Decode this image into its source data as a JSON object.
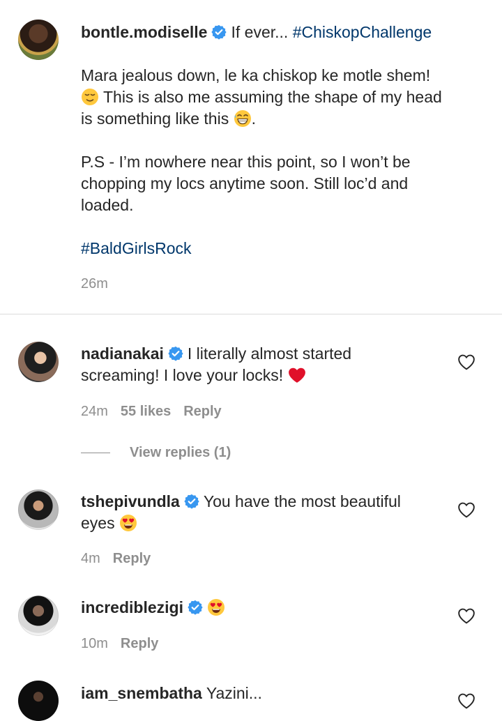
{
  "caption": {
    "username": "bontle.modiselle",
    "first_text": "If ever... ",
    "first_hashtag": "#ChiskopChallenge",
    "p1_a": "Mara jealous down, le ka chiskop ke motle shem!",
    "p1_b": "This is also me assuming the shape of my head",
    "p1_c": "is something like this",
    "p1_c_end": ".",
    "p2_a": "P.S - I’m nowhere near this point, so I won’t be",
    "p2_b": "chopping my locs anytime soon. Still loc’d and",
    "p2_c": "loaded.",
    "hashtag": "#BaldGirlsRock",
    "time": "26m"
  },
  "comments": [
    {
      "username": "nadianakai",
      "text_a": "I literally almost started",
      "text_b": "screaming! I love your locks!",
      "time": "24m",
      "likes": "55 likes",
      "reply": "Reply",
      "view_replies": "View replies (1)"
    },
    {
      "username": "tshepivundla",
      "text_a": "You have the most beautiful",
      "text_b": "eyes",
      "time": "4m",
      "reply": "Reply"
    },
    {
      "username": "incrediblezigi",
      "time": "10m",
      "reply": "Reply"
    },
    {
      "username": "iam_snembatha",
      "text_a": "Yazini..."
    }
  ],
  "colors": {
    "text": "#262626",
    "secondary": "#8e8e8e",
    "hashtag": "#00376b",
    "verified": "#3897f0",
    "heart_red": "#ed4956"
  },
  "icons": [
    "verified-badge-icon",
    "heart-outline-icon",
    "relieved-face-emoji",
    "grinning-sweat-emoji",
    "red-heart-emoji",
    "heart-eyes-emoji"
  ]
}
